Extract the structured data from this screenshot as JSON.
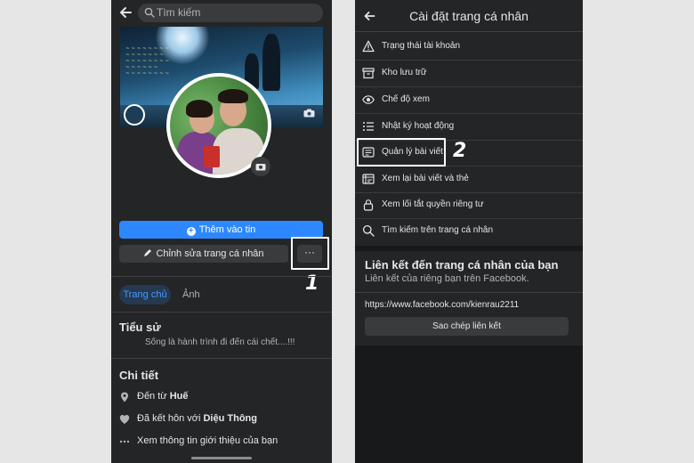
{
  "left": {
    "search": {
      "placeholder": "Tìm kiếm"
    },
    "add_story_label": "Thêm vào tin",
    "edit_profile_label": "Chỉnh sửa trang cá nhân",
    "more_label": "···",
    "step_1": "1",
    "tabs": [
      {
        "label": "Trang chủ",
        "active": true
      },
      {
        "label": "Ảnh",
        "active": false
      }
    ],
    "bio": {
      "heading": "Tiểu sử",
      "text": "Sống là hành trình đi đến cái chết....!!!"
    },
    "details": {
      "heading": "Chi tiết",
      "from_prefix": "Đến từ ",
      "from_value": "Huế",
      "married_prefix": "Đã kết hôn với ",
      "married_value": "Diệu Thông",
      "more_info": "Xem thông tin giới thiệu của bạn"
    }
  },
  "right": {
    "title": "Cài đặt trang cá nhân",
    "menu": [
      {
        "label": "Trạng thái tài khoản",
        "icon": "warning-icon"
      },
      {
        "label": "Kho lưu trữ",
        "icon": "archive-icon"
      },
      {
        "label": "Chế độ xem",
        "icon": "eye-icon"
      },
      {
        "label": "Nhật ký hoạt động",
        "icon": "activity-log-icon"
      },
      {
        "label": "Quản lý bài viết",
        "icon": "manage-posts-icon"
      },
      {
        "label": "Xem lại bài viết và thẻ",
        "icon": "review-posts-icon"
      },
      {
        "label": "Xem lối tắt quyền riêng tư",
        "icon": "lock-icon"
      },
      {
        "label": "Tìm kiếm trên trang cá nhân",
        "icon": "search-icon"
      }
    ],
    "step_2": "2",
    "link_section": {
      "title": "Liên kết đến trang cá nhân của bạn",
      "subtitle": "Liên kết của riêng bạn trên Facebook.",
      "url": "https://www.facebook.com/kienrau2211",
      "copy_label": "Sao chép liên kết"
    }
  },
  "colors": {
    "panel_bg": "#242526",
    "accent_blue": "#2d88ff",
    "text_primary": "#e4e6eb",
    "text_secondary": "#b0b3b8",
    "button_grey": "#3a3b3c"
  }
}
